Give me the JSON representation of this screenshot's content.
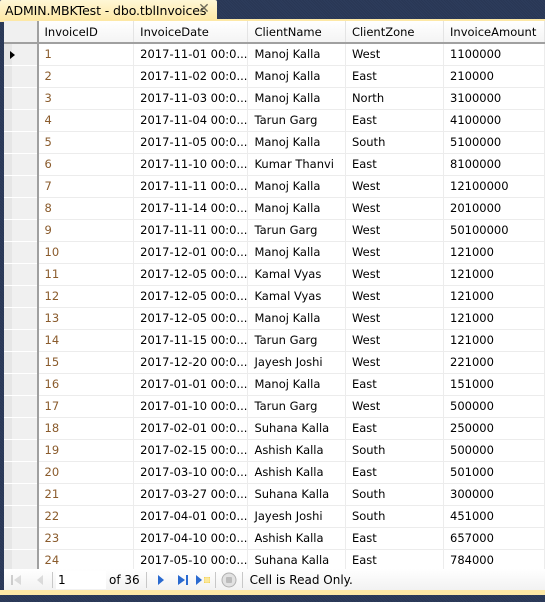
{
  "window": {
    "tab_title": "ADMIN.MBKTest - dbo.tblInvoices",
    "close_glyph": "✕"
  },
  "grid": {
    "columns": [
      "InvoiceID",
      "InvoiceDate",
      "ClientName",
      "ClientZone",
      "InvoiceAmount"
    ],
    "current_row_index": 0,
    "rows": [
      [
        "1",
        "2017-11-01 00:0...",
        "Manoj Kalla",
        "West",
        "1100000"
      ],
      [
        "2",
        "2017-11-02 00:0...",
        "Manoj Kalla",
        "East",
        "210000"
      ],
      [
        "3",
        "2017-11-03 00:0...",
        "Manoj Kalla",
        "North",
        "3100000"
      ],
      [
        "4",
        "2017-11-04 00:0...",
        "Tarun Garg",
        "East",
        "4100000"
      ],
      [
        "5",
        "2017-11-05 00:0...",
        "Manoj Kalla",
        "South",
        "5100000"
      ],
      [
        "6",
        "2017-11-10 00:0...",
        "Kumar Thanvi",
        "East",
        "8100000"
      ],
      [
        "7",
        "2017-11-11 00:0...",
        "Manoj Kalla",
        "West",
        "12100000"
      ],
      [
        "8",
        "2017-11-14 00:0...",
        "Manoj Kalla",
        "West",
        "2010000"
      ],
      [
        "9",
        "2017-11-11 00:0...",
        "Tarun Garg",
        "West",
        "50100000"
      ],
      [
        "10",
        "2017-12-01 00:0...",
        "Manoj Kalla",
        "West",
        "121000"
      ],
      [
        "11",
        "2017-12-05 00:0...",
        "Kamal Vyas",
        "West",
        "121000"
      ],
      [
        "12",
        "2017-12-05 00:0...",
        "Kamal Vyas",
        "West",
        "121000"
      ],
      [
        "13",
        "2017-12-05 00:0...",
        "Manoj Kalla",
        "West",
        "121000"
      ],
      [
        "14",
        "2017-11-15 00:0...",
        "Tarun Garg",
        "West",
        "121000"
      ],
      [
        "15",
        "2017-12-20 00:0...",
        "Jayesh Joshi",
        "West",
        "221000"
      ],
      [
        "16",
        "2017-01-01 00:0...",
        "Manoj Kalla",
        "East",
        "151000"
      ],
      [
        "17",
        "2017-01-10 00:0...",
        "Tarun Garg",
        "West",
        "500000"
      ],
      [
        "18",
        "2017-02-01 00:0...",
        "Suhana Kalla",
        "East",
        "250000"
      ],
      [
        "19",
        "2017-02-15 00:0...",
        "Ashish Kalla",
        "South",
        "500000"
      ],
      [
        "20",
        "2017-03-10 00:0...",
        "Ashish Kalla",
        "East",
        "501000"
      ],
      [
        "21",
        "2017-03-27 00:0...",
        "Suhana Kalla",
        "South",
        "300000"
      ],
      [
        "22",
        "2017-04-01 00:0...",
        "Jayesh Joshi",
        "South",
        "451000"
      ],
      [
        "23",
        "2017-04-10 00:0...",
        "Ashish Kalla",
        "East",
        "657000"
      ],
      [
        "24",
        "2017-05-10 00:0...",
        "Suhana Kalla",
        "East",
        "784000"
      ]
    ]
  },
  "navigator": {
    "current_page": "1",
    "of_text": "of 36",
    "status_text": "Cell is Read Only.",
    "icons": [
      "first-record-icon",
      "previous-record-icon",
      "next-record-icon",
      "last-record-icon",
      "new-record-icon",
      "stop-icon"
    ]
  },
  "colors": {
    "id_text": "#8a5b2c",
    "tab_background": "#fde8a6",
    "nav_arrow": "#2a6ad0"
  }
}
